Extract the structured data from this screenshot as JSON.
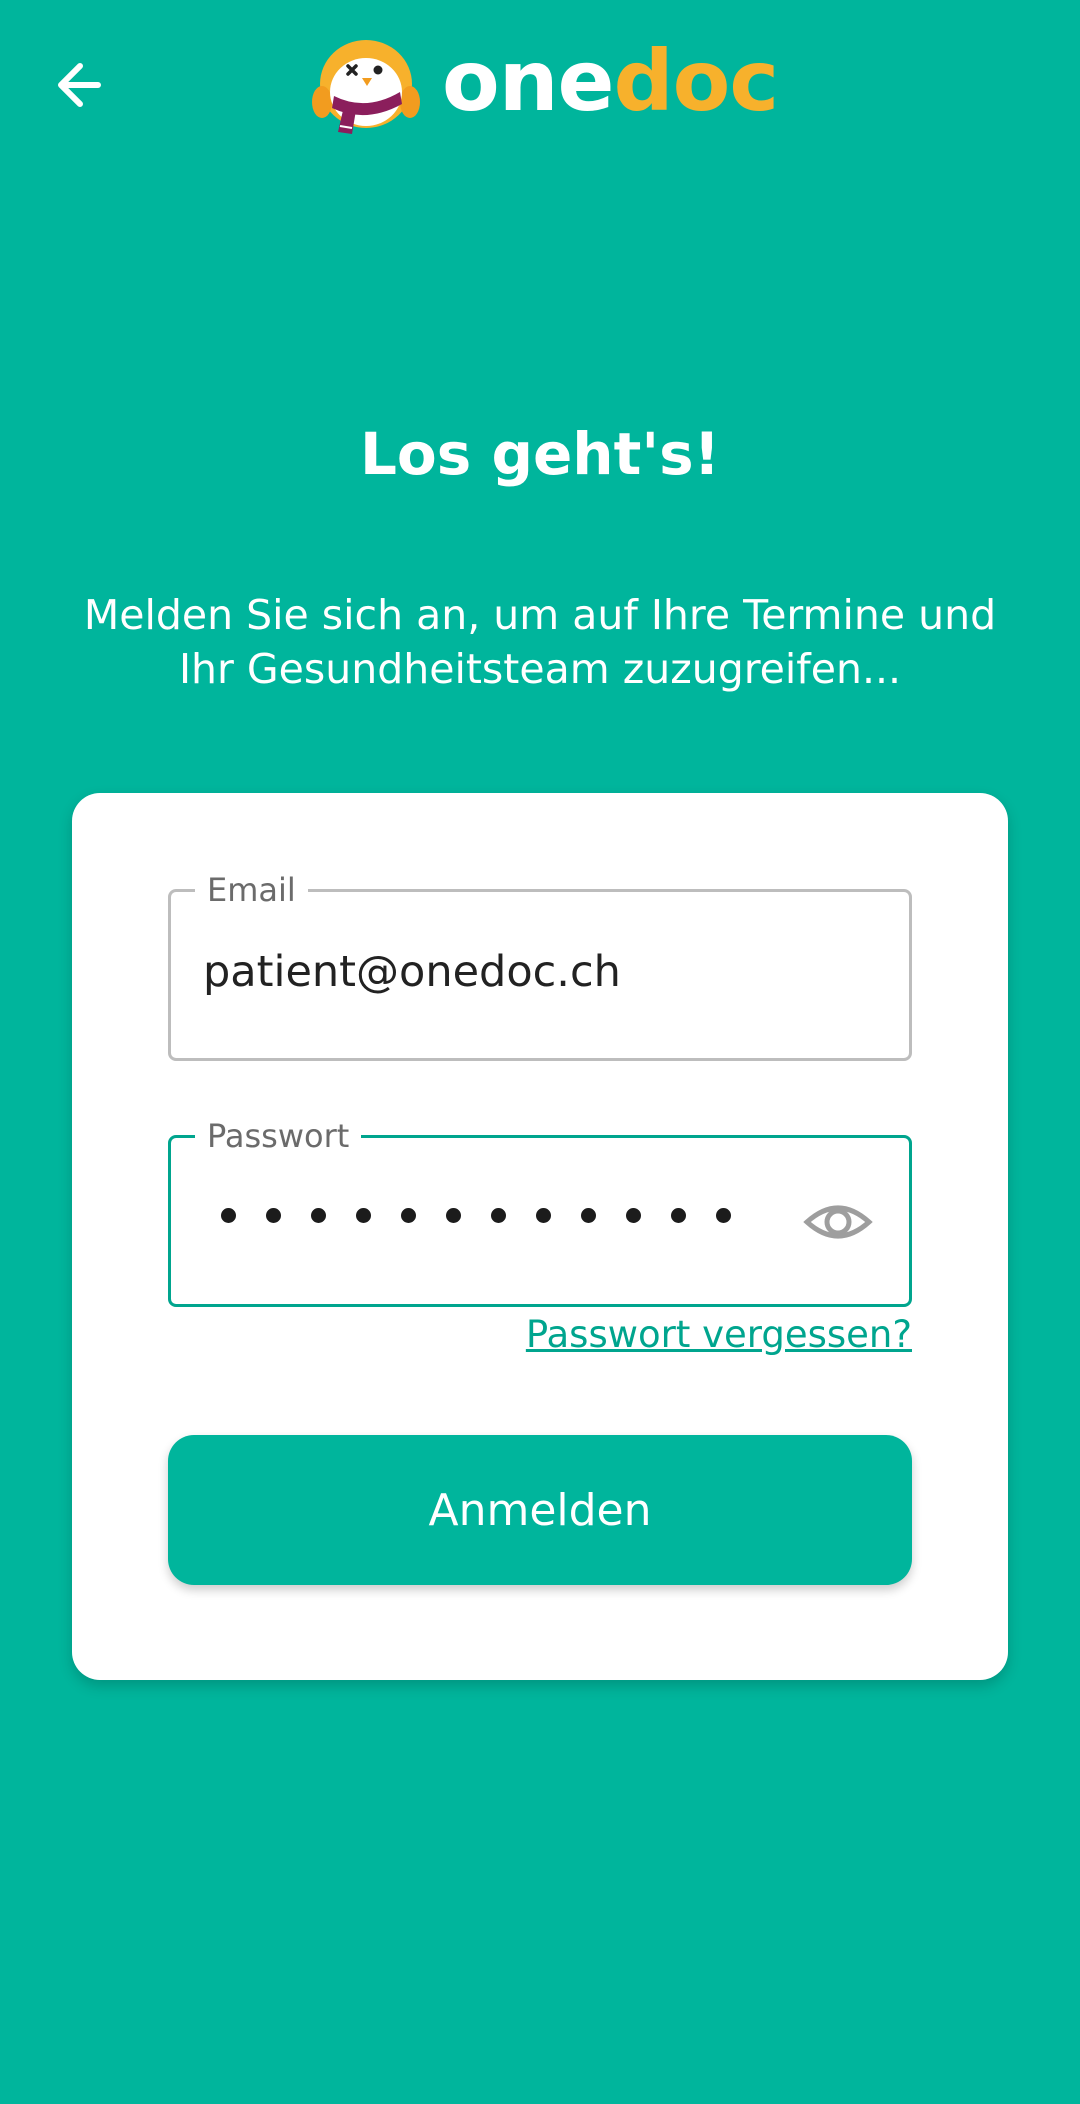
{
  "header": {
    "back_icon": "arrow-left-icon",
    "logo": {
      "mascot_icon": "penguin-mascot-icon",
      "word_one": "one",
      "word_doc": "doc"
    }
  },
  "main": {
    "title": "Los geht's!",
    "subtitle": "Melden Sie sich an, um auf Ihre Termine und Ihr Gesundheitsteam zuzugreifen..."
  },
  "form": {
    "email": {
      "label": "Email",
      "value": "patient@onedoc.ch"
    },
    "password": {
      "label": "Passwort",
      "masked_length": 12,
      "toggle_icon": "eye-icon"
    },
    "forgot_label": "Passwort vergessen?",
    "submit_label": "Anmelden"
  },
  "colors": {
    "background": "#00b59c",
    "accent": "#00a58e",
    "logo_doc": "#f7b12c",
    "card": "#ffffff"
  }
}
